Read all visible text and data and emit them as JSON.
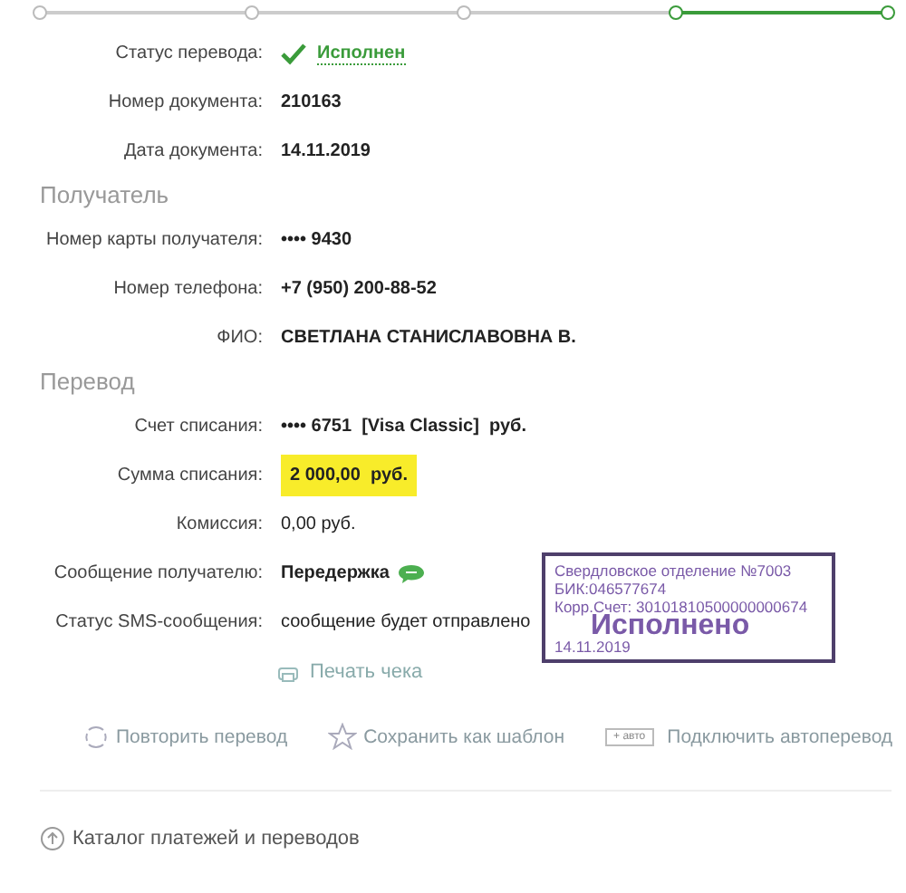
{
  "steps": [
    {
      "done": false
    },
    {
      "done": false
    },
    {
      "done": false
    },
    {
      "done": true
    },
    {
      "done": true
    }
  ],
  "sections": [
    {
      "rows": [
        {
          "label": "Статус перевода:",
          "value": "Исполнен",
          "kind": "status"
        },
        {
          "label": "Номер документа:",
          "value": "210163",
          "kind": "bold"
        },
        {
          "label": "Дата документа:",
          "value": "14.11.2019",
          "kind": "bold"
        }
      ]
    },
    {
      "title": "Получатель",
      "rows": [
        {
          "label": "Номер карты получателя:",
          "value": "•••• 9430",
          "kind": "bold"
        },
        {
          "label": "Номер телефона:",
          "value": "+7 (950) 200-88-52",
          "kind": "bold"
        },
        {
          "label": "ФИО:",
          "value": "СВЕТЛАНА СТАНИСЛАВОВНА В.",
          "kind": "bold"
        }
      ]
    },
    {
      "title": "Перевод",
      "rows": [
        {
          "label": "Счет списания:",
          "value": "•••• 6751  [Visa Classic]  руб.",
          "kind": "bold"
        },
        {
          "label": "Сумма списания:",
          "value": "2 000,00  руб.",
          "kind": "highlight"
        },
        {
          "label": "Комиссия:",
          "value": "0,00 руб.",
          "kind": "plain"
        },
        {
          "label": "Сообщение получателю:",
          "value": "Передержка",
          "kind": "message"
        },
        {
          "label": "Статус SMS-сообщения:",
          "value": "сообщение будет отправлено",
          "kind": "plain"
        }
      ]
    }
  ],
  "print": "Печать чека",
  "stamp": {
    "lines": [
      "Свердловское отделение №7003",
      "БИК:046577674",
      "Корр.Счет: 30101810500000000674"
    ],
    "status": "Исполнено",
    "date": "14.11.2019"
  },
  "actions": [
    {
      "kind": "repeat",
      "label": "Повторить перевод"
    },
    {
      "kind": "star",
      "label": "Сохранить как шаблон"
    },
    {
      "kind": "auto",
      "badge": "+ авто",
      "label": "Подключить автоперевод"
    }
  ],
  "catalog": "Каталог платежей и переводов"
}
